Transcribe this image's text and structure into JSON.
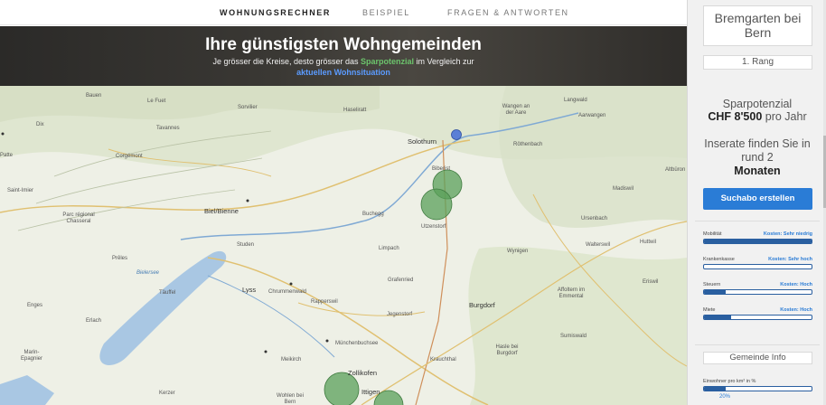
{
  "nav": {
    "items": [
      "WOHNUNGSRECHNER",
      "BEISPIEL",
      "FRAGEN & ANTWORTEN"
    ],
    "active": "WOHNUNGSRECHNER"
  },
  "banner": {
    "title": "Ihre günstigsten Wohngemeinden",
    "sub_pre": "Je grösser die Kreise, desto grösser das ",
    "sub_green": "Sparpotenzial",
    "sub_mid": " im Vergleich zur",
    "sub_blue": "aktuellen Wohnsituation"
  },
  "map": {
    "places": [
      "Le Fuet",
      "Sorvilier",
      "Haseliratt",
      "Wangen an der Aare",
      "Langwald",
      "Aarwangen",
      "Tavannes",
      "Solothurn",
      "Röthenbach",
      "Corgémont",
      "Altbüron",
      "Biberist",
      "Saint-Imier",
      "Madiswil",
      "Parc régional Chasseral",
      "Biel/Bienne",
      "Buchegg",
      "Ursenbach",
      "Utzenstorf",
      "Walterswil",
      "Huttwil",
      "Studen",
      "Limpach",
      "Wynigen",
      "Prêles",
      "Bielersee",
      "Grafenried",
      "Eriswil",
      "Täuffel",
      "Lyss",
      "Chrummenwald",
      "Affoltern im Emmental",
      "Rapperswil",
      "Burgdorf",
      "Enges",
      "Jegenstorf",
      "Erlach",
      "Sumiswald",
      "Münchenbuchsee",
      "Hasle bei Burgdorf",
      "Marin-Epagnier",
      "Meikirch",
      "Krauchthal",
      "Zollikofen",
      "Kerzer",
      "Wohlen bei Bern",
      "Ittigen",
      "Patte",
      "Dix",
      "Bauen"
    ],
    "current_location_color": "#5b7fd6",
    "circle_color": "#5aa05a"
  },
  "panel": {
    "town": "Bremgarten bei Bern",
    "rank": "1. Rang",
    "saving_label": "Sparpotenzial",
    "saving_value": "CHF 8'500",
    "saving_unit": " pro Jahr",
    "find_label": "Inserate finden Sie in rund 2",
    "find_value": "Monaten",
    "button": "Suchabo erstellen",
    "metrics": [
      {
        "label": "Mobilität",
        "value": "Kosten: Sehr niedrig",
        "level": 1.0
      },
      {
        "label": "Krankenkasse",
        "value": "Kosten: Sehr hoch",
        "level": 0.0
      },
      {
        "label": "Steuern",
        "value": "Kosten: Hoch",
        "level": 0.2
      },
      {
        "label": "Miete",
        "value": "Kosten: Hoch",
        "level": 0.25
      }
    ],
    "gemeinde_info": "Gemeinde Info",
    "density_label": "Einwohner pro km² in %",
    "density_pct": "20%",
    "density_level": 0.2
  }
}
